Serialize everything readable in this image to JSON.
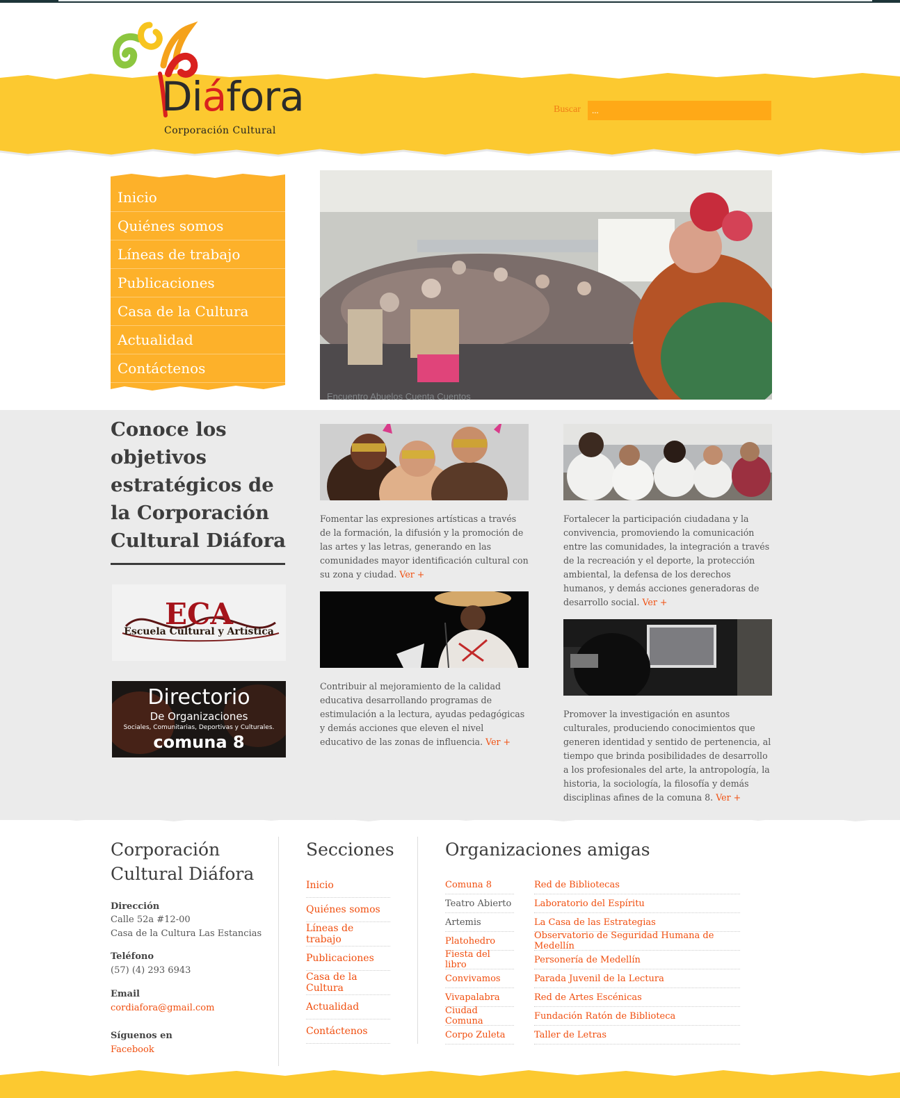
{
  "header": {
    "logo_name_prefix": "Di",
    "logo_name_accent": "á",
    "logo_name_suffix": "fora",
    "logo_subtitle": "Corporación Cultural",
    "search_label": "Buscar",
    "search_value": "..."
  },
  "nav": {
    "items": [
      "Inicio",
      "Quiénes somos",
      "Líneas de trabajo",
      "Publicaciones",
      "Casa de la Cultura",
      "Actualidad",
      "Contáctenos"
    ]
  },
  "hero": {
    "caption": "Encuentro Abuelos Cuenta Cuentos"
  },
  "intro": {
    "title": "Conoce los objetivos estratégicos de la Corporación Cultural Diáfora"
  },
  "banners": {
    "eca_title": "ECA",
    "eca_subtitle": "Escuela Cultural y Artística",
    "dir_line1": "Directorio",
    "dir_line2": "De Organizaciones",
    "dir_line3": "Sociales, Comunitarias, Deportivas y Culturales.",
    "dir_line4": "comuna 8"
  },
  "cards": [
    {
      "text": "Fomentar las expresiones artísticas a través de la formación, la difusión y la promoción de las artes y las letras, generando en las comunidades mayor identificación cultural con su zona y ciudad.",
      "more": "Ver +"
    },
    {
      "text": "Fortalecer la participación ciudadana y la convivencia, promoviendo la comunicación entre las comunidades, la integración a través de la recreación y el deporte, la protección ambiental, la defensa de los derechos humanos, y demás acciones generadoras de desarrollo social.",
      "more": "Ver +"
    },
    {
      "text": "Contribuir al mejoramiento de la calidad educativa desarrollando programas de estimulación a la lectura, ayudas pedagógicas y demás acciones que eleven el nivel educativo de las zonas de influencia.",
      "more": "Ver +"
    },
    {
      "text": "Promover la investigación en asuntos culturales, produciendo conocimientos que generen identidad y sentido de pertenencia, al tiempo que brinda posibilidades de desarrollo a los profesionales del arte, la antropología, la historia, la sociología, la filosofía y demás disciplinas afines de la comuna 8.",
      "more": "Ver +"
    }
  ],
  "footer": {
    "org_title": "Corporación Cultural Diáfora",
    "address_label": "Dirección",
    "address_line1": "Calle 52a #12-00",
    "address_line2": "Casa de la Cultura Las Estancias",
    "phone_label": "Teléfono",
    "phone": "(57) (4) 293 6943",
    "email_label": "Email",
    "email": "cordiafora@gmail.com",
    "social_label": "Síguenos en",
    "social_link": "Facebook",
    "sections_title": "Secciones",
    "sections": [
      "Inicio",
      "Quiénes somos",
      "Líneas de trabajo",
      "Publicaciones",
      "Casa de la Cultura",
      "Actualidad",
      "Contáctenos"
    ],
    "friends_title": "Organizaciones amigas",
    "friends_col1": [
      {
        "label": "Comuna 8",
        "link": true
      },
      {
        "label": "Teatro Abierto",
        "link": false
      },
      {
        "label": "Artemis",
        "link": false
      },
      {
        "label": "Platohedro",
        "link": true
      },
      {
        "label": "Fiesta del libro",
        "link": true
      },
      {
        "label": "Convivamos",
        "link": true
      },
      {
        "label": "Vivapalabra",
        "link": true
      },
      {
        "label": "Ciudad Comuna",
        "link": true
      },
      {
        "label": "Corpo Zuleta",
        "link": true
      }
    ],
    "friends_col2": [
      {
        "label": "Red de Bibliotecas",
        "link": true
      },
      {
        "label": "Laboratorio del Espíritu",
        "link": true
      },
      {
        "label": "La Casa de las Estrategias",
        "link": true
      },
      {
        "label": "Observatorio de Seguridad Humana de Medellín",
        "link": true
      },
      {
        "label": "Personería de Medellín",
        "link": true
      },
      {
        "label": "Parada Juvenil de la Lectura",
        "link": true
      },
      {
        "label": "Red de Artes Escénicas",
        "link": true
      },
      {
        "label": "Fundación Ratón de Biblioteca",
        "link": true
      },
      {
        "label": "Taller de Letras",
        "link": true
      }
    ]
  },
  "colors": {
    "accent_yellow": "#fcc930",
    "nav_orange": "#fdb12a",
    "link_orange": "#f04e0e",
    "gray_section": "#ebebeb",
    "dark_text": "#3d3d3d"
  }
}
